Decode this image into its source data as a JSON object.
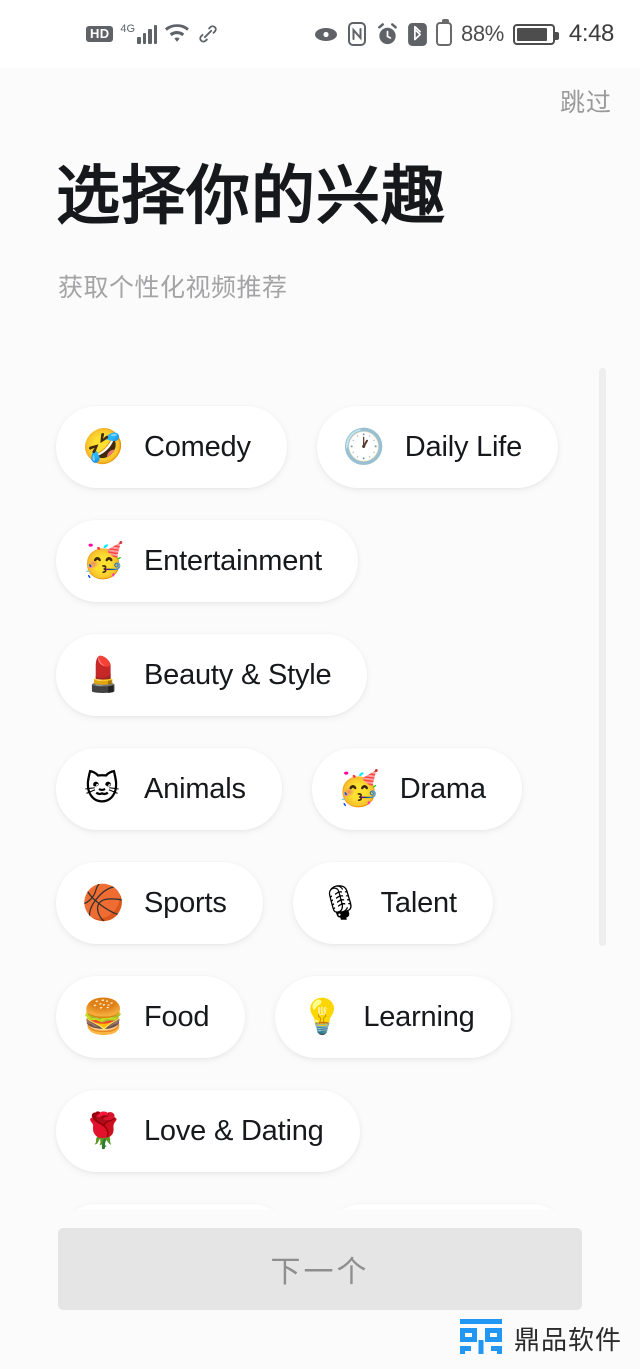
{
  "status_bar": {
    "hd_label": "HD",
    "network_type": "4G",
    "signal_bars": 4,
    "wifi": "wifi-icon",
    "link": "link-icon",
    "eye": "eye-icon",
    "nfc": "nfc-icon",
    "alarm": "alarm-icon",
    "bluetooth": "bluetooth-icon",
    "second_battery": "secondary-battery-icon",
    "battery_percent": "88%",
    "battery_level": 88,
    "time": "4:48"
  },
  "header": {
    "skip_label": "跳过",
    "title": "选择你的兴趣",
    "subtitle": "获取个性化视频推荐"
  },
  "interests": [
    {
      "label": "Comedy",
      "emoji": "🤣",
      "icon_name": "rolling-on-floor-laughing-emoji",
      "selected": false
    },
    {
      "label": "Daily Life",
      "emoji": "🕐",
      "icon_name": "clock-emoji",
      "selected": false
    },
    {
      "label": "Entertainment",
      "emoji": "🥳",
      "icon_name": "partying-face-emoji",
      "selected": false
    },
    {
      "label": "Beauty & Style",
      "emoji": "💄",
      "icon_name": "lipstick-emoji",
      "selected": false
    },
    {
      "label": "Animals",
      "emoji": "🐱",
      "icon_name": "cat-face-emoji",
      "selected": false
    },
    {
      "label": "Drama",
      "emoji": "🥳",
      "icon_name": "partying-face-emoji",
      "selected": false
    },
    {
      "label": "Sports",
      "emoji": "🏀",
      "icon_name": "basketball-emoji",
      "selected": false
    },
    {
      "label": "Talent",
      "emoji": "🎙",
      "icon_name": "studio-microphone-emoji",
      "selected": false
    },
    {
      "label": "Food",
      "emoji": "🍔",
      "icon_name": "hamburger-emoji",
      "selected": false
    },
    {
      "label": "Learning",
      "emoji": "💡",
      "icon_name": "light-bulb-emoji",
      "selected": false
    },
    {
      "label": "Love & Dating",
      "emoji": "🌹",
      "icon_name": "rose-emoji",
      "selected": false
    }
  ],
  "footer": {
    "next_label": "下一个",
    "next_enabled": false
  },
  "watermark": {
    "text": "鼎品软件",
    "logo_color": "#2196f3"
  },
  "colors": {
    "page_background": "#fbfbfb",
    "chip_background": "#ffffff",
    "title_text": "#16181c",
    "subtitle_text": "#a4a4a6",
    "cta_background": "#e5e5e5",
    "cta_text": "#8e8e8e",
    "scrollbar": "#eeeeee"
  }
}
